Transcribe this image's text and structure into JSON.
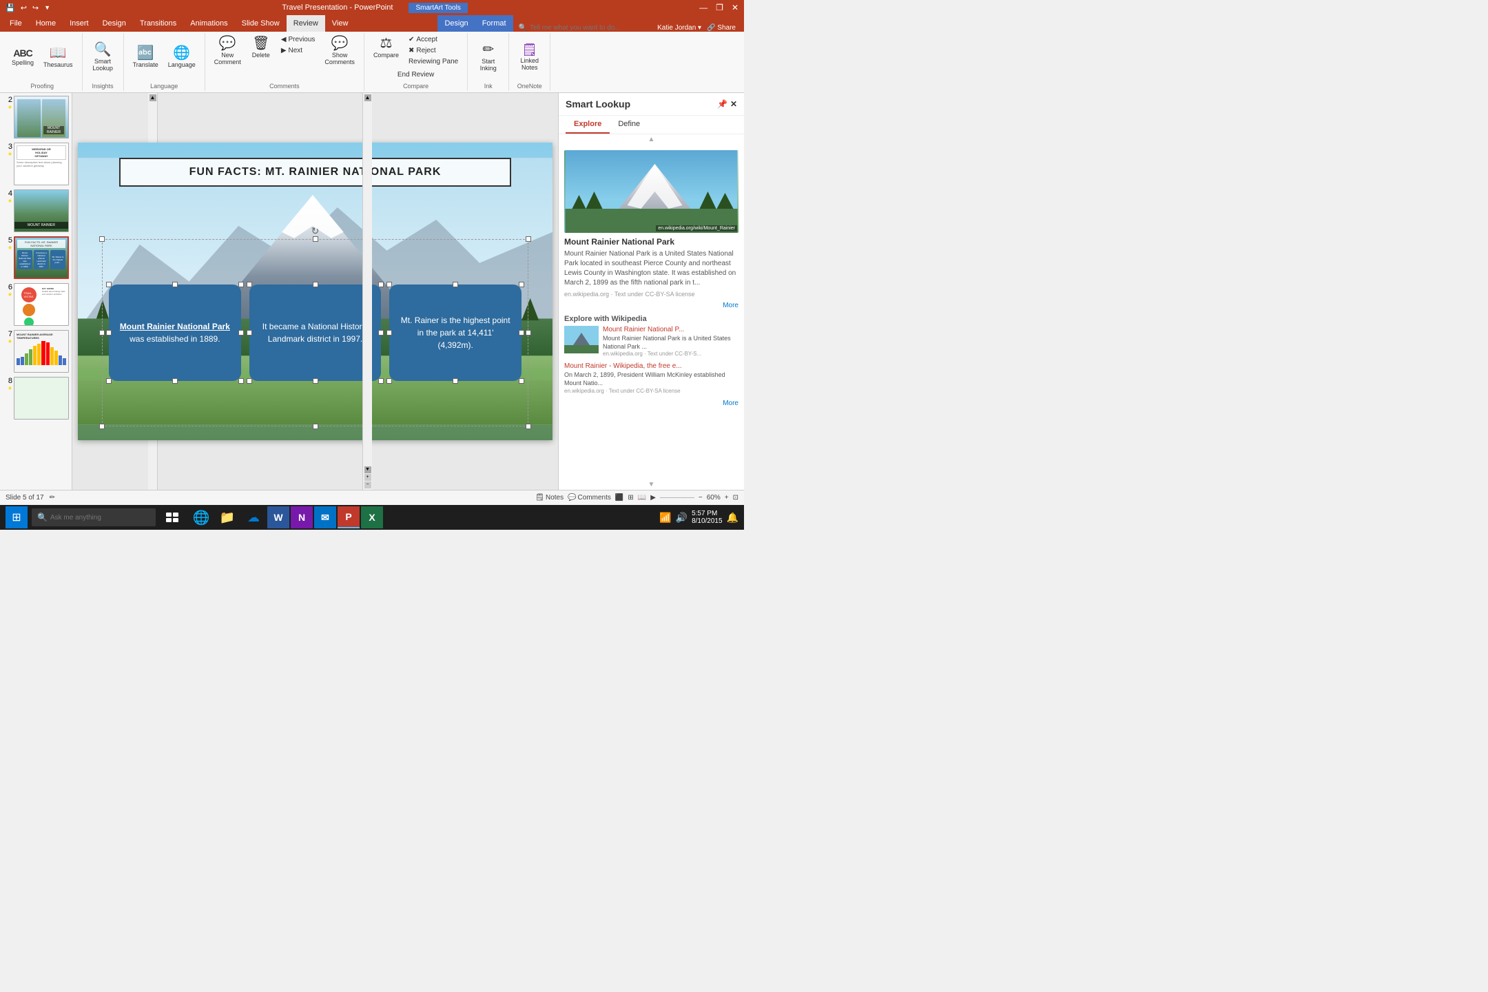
{
  "titleBar": {
    "saveIcon": "💾",
    "undoIcon": "↩",
    "redoIcon": "↪",
    "title": "Travel Presentation - PowerPoint",
    "smartartTools": "SmartArt Tools",
    "minIcon": "—",
    "restoreIcon": "❐",
    "closeIcon": "✕"
  },
  "ribbonTabs": {
    "tabs": [
      "File",
      "Home",
      "Insert",
      "Design",
      "Transitions",
      "Animations",
      "Slide Show",
      "Review",
      "View",
      "Design",
      "Format"
    ],
    "activeTab": "Review",
    "smartartTab": "SmartArt Tools",
    "searchPlaceholder": "Tell me what you want to do..."
  },
  "ribbonGroups": {
    "proofing": {
      "label": "Proofing",
      "buttons": [
        {
          "label": "Spelling",
          "icon": "ABC"
        },
        {
          "label": "Thesaurus",
          "icon": "📖"
        }
      ]
    },
    "insights": {
      "label": "Insights",
      "buttons": [
        {
          "label": "Smart\nLookup",
          "icon": "🔍"
        }
      ]
    },
    "language": {
      "label": "Language",
      "buttons": [
        {
          "label": "Translate",
          "icon": "🔤"
        },
        {
          "label": "Language",
          "icon": "🌐"
        }
      ]
    },
    "comments": {
      "label": "Comments",
      "buttons": [
        {
          "label": "New\nComment",
          "icon": "💬"
        },
        {
          "label": "Delete",
          "icon": "🗑"
        },
        {
          "label": "Previous",
          "icon": "◀"
        },
        {
          "label": "Next",
          "icon": "▶"
        },
        {
          "label": "Show\nComments",
          "icon": "💬"
        }
      ]
    },
    "compare": {
      "label": "Compare",
      "buttons": [
        {
          "label": "Compare",
          "icon": "⚖"
        },
        {
          "label": "Accept",
          "icon": "✔"
        },
        {
          "label": "Reject",
          "icon": "✖"
        }
      ]
    },
    "ink": {
      "label": "Ink",
      "buttons": [
        {
          "label": "Start\nInking",
          "icon": "✏"
        }
      ]
    },
    "onenote": {
      "label": "OneNote",
      "buttons": [
        {
          "label": "Linked\nNotes",
          "icon": "🗒"
        }
      ]
    }
  },
  "slides": [
    {
      "num": "2",
      "hasStar": true,
      "type": "travel"
    },
    {
      "num": "3",
      "hasStar": true,
      "type": "holiday"
    },
    {
      "num": "4",
      "hasStar": true,
      "type": "rainier"
    },
    {
      "num": "5",
      "hasStar": true,
      "type": "funfacts",
      "active": true
    },
    {
      "num": "6",
      "hasStar": true,
      "type": "circles"
    },
    {
      "num": "7",
      "hasStar": true,
      "type": "temps"
    },
    {
      "num": "8",
      "hasStar": true,
      "type": "green"
    }
  ],
  "currentSlide": {
    "title": "FUN FACTS: MT. RAINIER NATIONAL PARK",
    "box1": {
      "highlighted": "Mount Rainier National Park",
      "text": " was  established in 1889."
    },
    "box2": "It became a National Historic Landmark district in 1997.",
    "box3": "Mt. Rainer is the highest point in the park at 14,411' (4,392m)."
  },
  "smartLookup": {
    "title": "Smart Lookup",
    "tabs": [
      "Explore",
      "Define"
    ],
    "activeTab": "Explore",
    "mainResult": {
      "title": "Mount Rainier National Park",
      "description": "Mount Rainier National Park is a United States National Park located in southeast Pierce County and northeast Lewis County in Washington state. It was established on March 2, 1899 as the fifth national park in t...",
      "source": "en.wikipedia.org",
      "license": "Text under CC-BY-SA license"
    },
    "exploreSection": "Explore with Wikipedia",
    "results": [
      {
        "title": "Mount Rainier National P...",
        "description": "Mount Rainier National Park is a United States National Park ...",
        "source": "en.wikipedia.org · Text under CC-BY-S..."
      },
      {
        "title": "Mount Rainier - Wikipedia, the free e...",
        "description": "On March 2, 1899, President William McKinley established Mount Natio...",
        "source": "en.wikipedia.org · Text under CC-BY-SA license"
      }
    ],
    "moreLabel": "More"
  },
  "statusBar": {
    "slideInfo": "Slide 5 of 17",
    "notesLabel": "Notes",
    "commentsLabel": "Comments"
  },
  "taskbar": {
    "time": "5:57 PM",
    "date": "8/10/2015",
    "searchPlaceholder": "Ask me anything",
    "apps": [
      "🌐",
      "📁",
      "☁",
      "W",
      "N",
      "✉",
      "P",
      "X"
    ]
  }
}
